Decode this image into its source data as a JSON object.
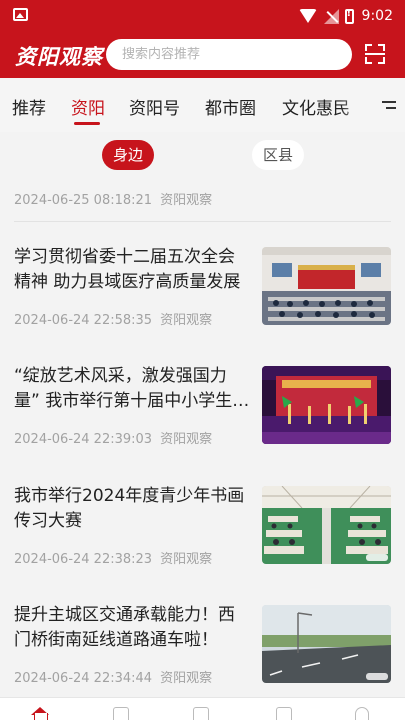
{
  "status_bar": {
    "time": "9:02"
  },
  "header": {
    "logo_text": "资阳观察",
    "search_placeholder": "搜索内容推荐"
  },
  "tabs": [
    {
      "label": "推荐",
      "active": false
    },
    {
      "label": "资阳",
      "active": true
    },
    {
      "label": "资阳号",
      "active": false
    },
    {
      "label": "都市圈",
      "active": false
    },
    {
      "label": "文化惠民",
      "active": false
    }
  ],
  "segments": {
    "nearby": "身边",
    "district": "区县"
  },
  "top_partial": {
    "datetime": "2024-06-25 08:18:21",
    "source": "资阳观察"
  },
  "news": [
    {
      "title": "学习贯彻省委十二届五次全会精神 助力县域医疗高质量发展",
      "datetime": "2024-06-24 22:58:35",
      "source": "资阳观察",
      "image": "meeting-hall-photo"
    },
    {
      "title": "“绽放艺术风采，激发强国力量” 我市举行第十届中小学生艺术展演活动",
      "datetime": "2024-06-24 22:39:03",
      "source": "资阳观察",
      "image": "stage-performance-photo"
    },
    {
      "title": "我市举行2024年度青少年书画传习大赛",
      "datetime": "2024-06-24 22:38:23",
      "source": "资阳观察",
      "image": "gymnasium-contest-photo"
    },
    {
      "title": "提升主城区交通承载能力！西门桥街南延线道路通车啦！",
      "datetime": "2024-06-24 22:34:44",
      "source": "资阳观察",
      "image": "new-road-photo"
    }
  ],
  "colors": {
    "brand_red": "#c7141c"
  }
}
